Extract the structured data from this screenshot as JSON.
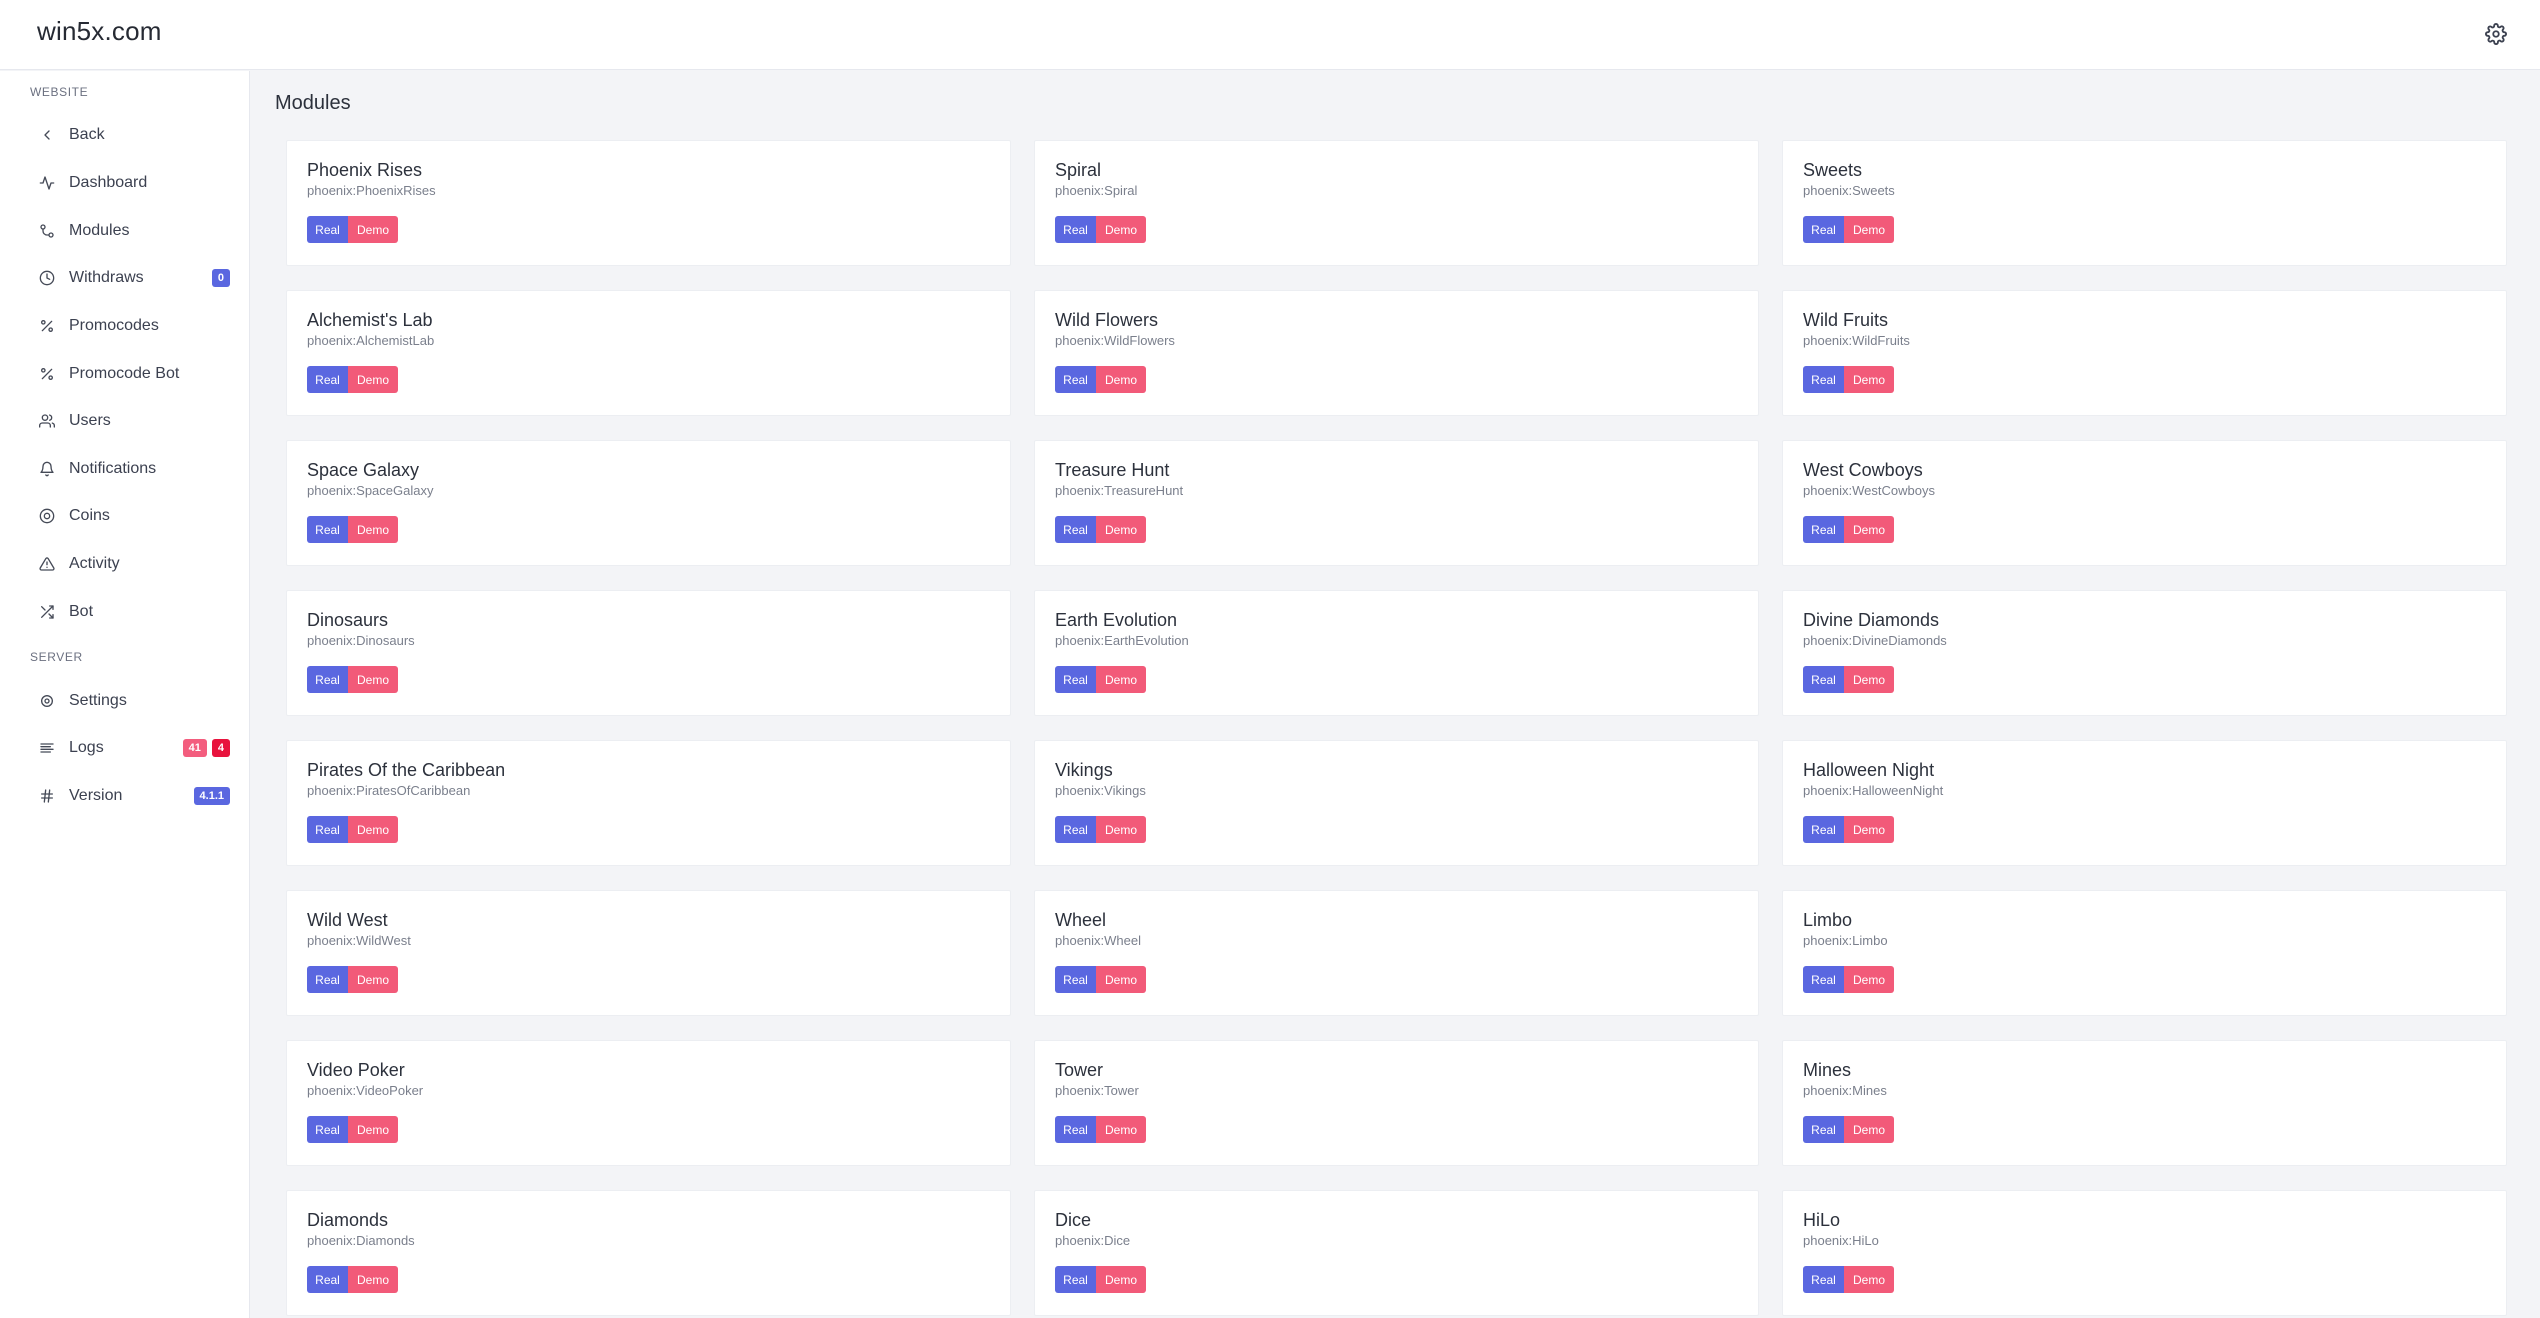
{
  "brand": "win5x.com",
  "sidebar": {
    "section_website": "WEBSITE",
    "section_server": "SERVER",
    "items": [
      {
        "id": "back",
        "label": "Back",
        "icon": "chevron-left-icon"
      },
      {
        "id": "dashboard",
        "label": "Dashboard",
        "icon": "activity-icon"
      },
      {
        "id": "modules",
        "label": "Modules",
        "icon": "git-commit-icon"
      },
      {
        "id": "withdraws",
        "label": "Withdraws",
        "icon": "clock-icon",
        "badge": "0"
      },
      {
        "id": "promocodes",
        "label": "Promocodes",
        "icon": "percent-icon"
      },
      {
        "id": "promocode-bot",
        "label": "Promocode Bot",
        "icon": "percent-icon"
      },
      {
        "id": "users",
        "label": "Users",
        "icon": "users-icon"
      },
      {
        "id": "notifications",
        "label": "Notifications",
        "icon": "bell-icon"
      },
      {
        "id": "coins",
        "label": "Coins",
        "icon": "target-icon"
      },
      {
        "id": "activity",
        "label": "Activity",
        "icon": "alert-triangle-icon"
      },
      {
        "id": "bot",
        "label": "Bot",
        "icon": "shuffle-icon"
      }
    ],
    "server_items": [
      {
        "id": "settings",
        "label": "Settings",
        "icon": "gear-icon"
      },
      {
        "id": "logs",
        "label": "Logs",
        "icon": "align-left-icon",
        "badge1": "41",
        "badge2": "4"
      },
      {
        "id": "version",
        "label": "Version",
        "icon": "hash-icon",
        "badge": "4.1.1"
      }
    ]
  },
  "main": {
    "title": "Modules",
    "real_label": "Real",
    "demo_label": "Demo",
    "modules": [
      {
        "name": "Phoenix Rises",
        "key": "phoenix:PhoenixRises"
      },
      {
        "name": "Spiral",
        "key": "phoenix:Spiral"
      },
      {
        "name": "Sweets",
        "key": "phoenix:Sweets"
      },
      {
        "name": "Alchemist's Lab",
        "key": "phoenix:AlchemistLab"
      },
      {
        "name": "Wild Flowers",
        "key": "phoenix:WildFlowers"
      },
      {
        "name": "Wild Fruits",
        "key": "phoenix:WildFruits"
      },
      {
        "name": "Space Galaxy",
        "key": "phoenix:SpaceGalaxy"
      },
      {
        "name": "Treasure Hunt",
        "key": "phoenix:TreasureHunt"
      },
      {
        "name": "West Cowboys",
        "key": "phoenix:WestCowboys"
      },
      {
        "name": "Dinosaurs",
        "key": "phoenix:Dinosaurs"
      },
      {
        "name": "Earth Evolution",
        "key": "phoenix:EarthEvolution"
      },
      {
        "name": "Divine Diamonds",
        "key": "phoenix:DivineDiamonds"
      },
      {
        "name": "Pirates Of the Caribbean",
        "key": "phoenix:PiratesOfCaribbean"
      },
      {
        "name": "Vikings",
        "key": "phoenix:Vikings"
      },
      {
        "name": "Halloween Night",
        "key": "phoenix:HalloweenNight"
      },
      {
        "name": "Wild West",
        "key": "phoenix:WildWest"
      },
      {
        "name": "Wheel",
        "key": "phoenix:Wheel"
      },
      {
        "name": "Limbo",
        "key": "phoenix:Limbo"
      },
      {
        "name": "Video Poker",
        "key": "phoenix:VideoPoker"
      },
      {
        "name": "Tower",
        "key": "phoenix:Tower"
      },
      {
        "name": "Mines",
        "key": "phoenix:Mines"
      },
      {
        "name": "Diamonds",
        "key": "phoenix:Diamonds"
      },
      {
        "name": "Dice",
        "key": "phoenix:Dice"
      },
      {
        "name": "HiLo",
        "key": "phoenix:HiLo"
      }
    ]
  },
  "colors": {
    "primary": "#5a67e0",
    "danger": "#f25a79",
    "badge_red": "#e8133d"
  }
}
